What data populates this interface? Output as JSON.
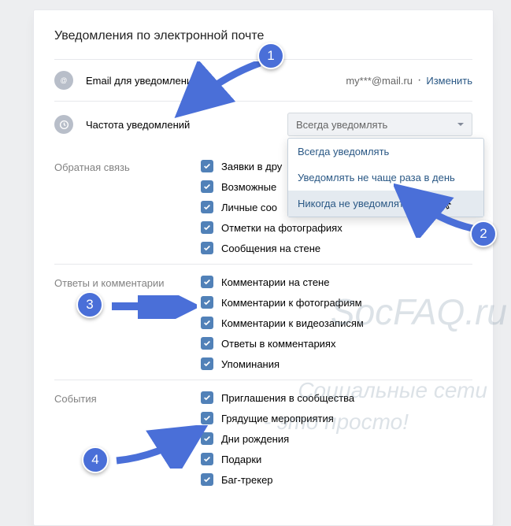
{
  "page_title": "Уведомления по электронной почте",
  "email_row": {
    "label": "Email для уведомлений",
    "value": "my***@mail.ru",
    "change": "Изменить"
  },
  "frequency_row": {
    "label": "Частота уведомлений",
    "selected": "Всегда уведомлять",
    "options": [
      "Всегда уведомлять",
      "Уведомлять не чаще раза в день",
      "Никогда не уведомлять"
    ]
  },
  "sections": {
    "feedback": {
      "title": "Обратная связь",
      "items": [
        "Заявки в дру",
        "Возможные",
        "Личные соо",
        "Отметки на фотографиях",
        "Сообщения на стене"
      ]
    },
    "replies": {
      "title": "Ответы и комментарии",
      "items": [
        "Комментарии на стене",
        "Комментарии к фотографиям",
        "Комментарии к видеозаписям",
        "Ответы в комментариях",
        "Упоминания"
      ]
    },
    "events": {
      "title": "События",
      "items": [
        "Приглашения в сообщества",
        "Грядущие мероприятия",
        "Дни рождения",
        "Подарки",
        "Баг-трекер"
      ]
    }
  },
  "badges": {
    "b1": "1",
    "b2": "2",
    "b3": "3",
    "b4": "4"
  },
  "watermark": {
    "line1": "SocFAQ.ru",
    "line2": "Социальные сети",
    "line3": "- это просто!"
  }
}
